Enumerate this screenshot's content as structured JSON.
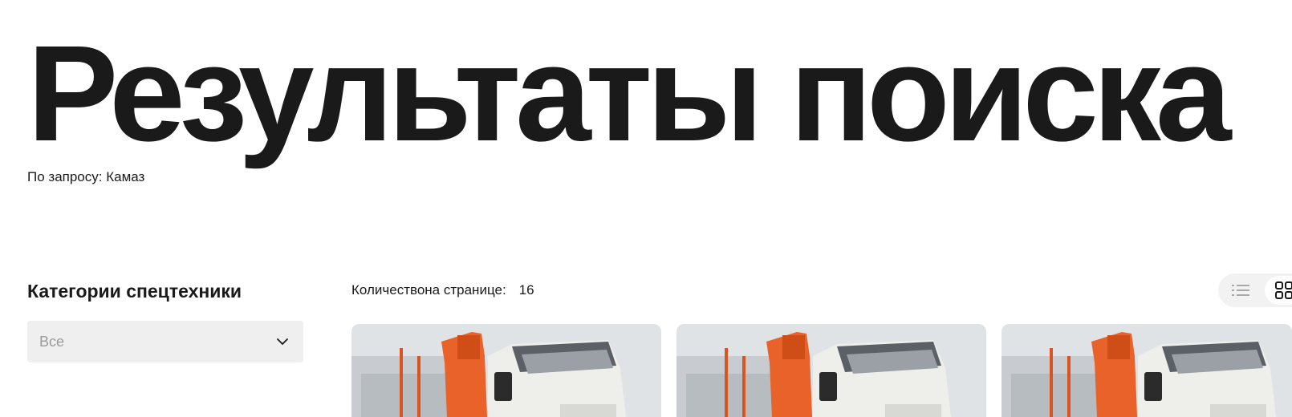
{
  "header": {
    "title": "Результаты поиска",
    "query_label": "По запросу:",
    "query_value": "Камаз"
  },
  "sidebar": {
    "title": "Категории спецтехники",
    "category_select": {
      "value": "Все",
      "icon": "chevron-down-icon"
    }
  },
  "results": {
    "count_label": "Количествона странице:",
    "count_value": "16",
    "view_toggle": {
      "list_icon": "list-view-icon",
      "grid_icon": "grid-view-icon",
      "active": "grid"
    },
    "cards": [
      {
        "image": "kamaz-timber-truck-photo"
      },
      {
        "image": "kamaz-timber-truck-photo"
      },
      {
        "image": "kamaz-timber-truck-photo"
      }
    ]
  },
  "colors": {
    "text": "#1a1a1a",
    "select_bg": "#efefef",
    "placeholder": "#9a9a9a",
    "truck_orange": "#e8622a",
    "toggle_bg": "#f2f2f2"
  }
}
